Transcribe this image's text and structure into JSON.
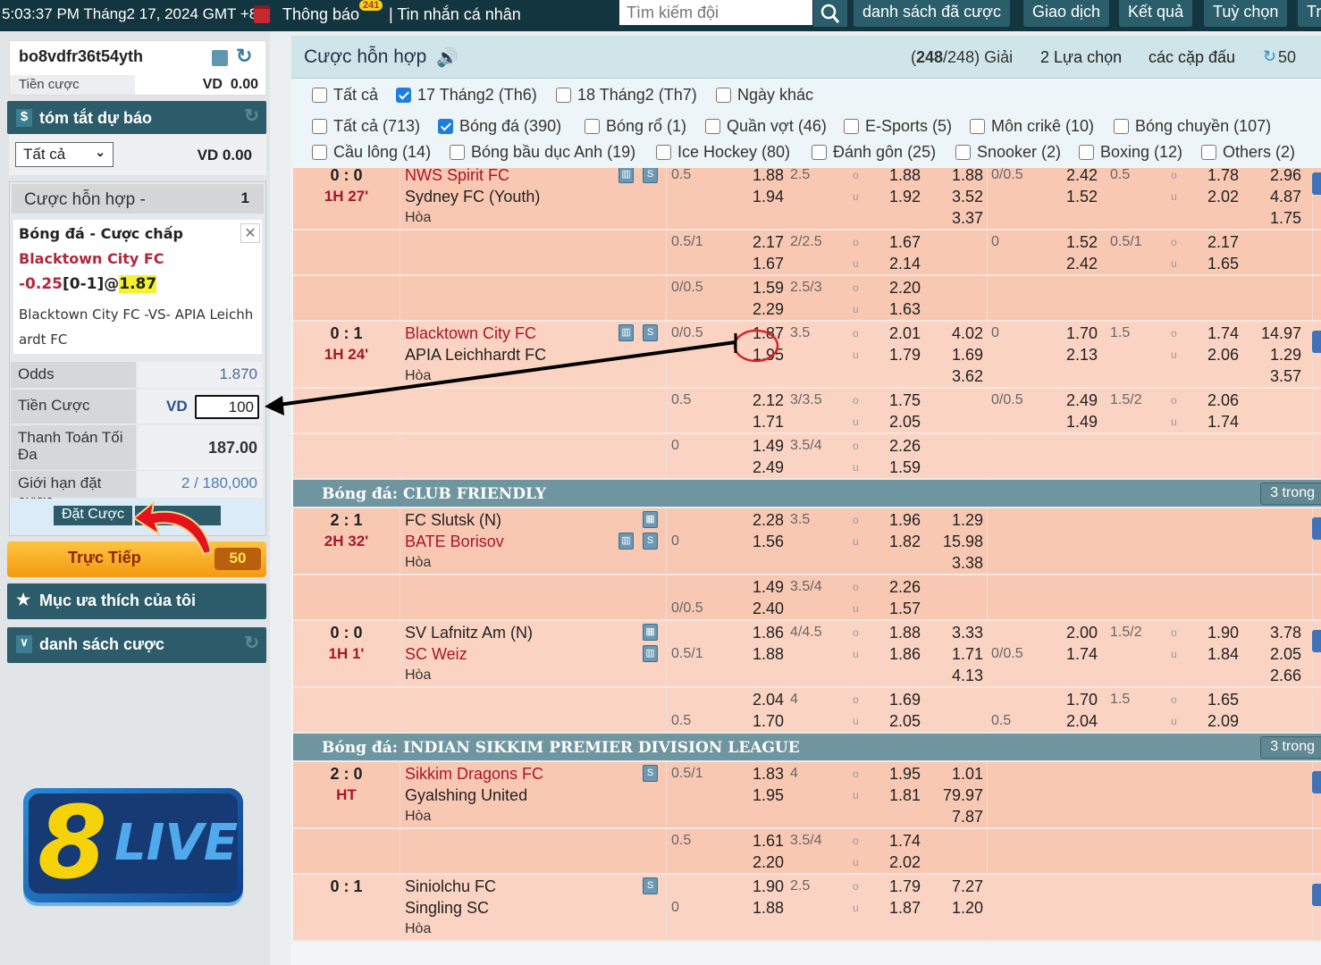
{
  "topbar": {
    "datetime": "5:03:37 PM Tháng2 17, 2024 GMT +8",
    "notifications_label": "Thông báo",
    "notifications_count": "241",
    "messages_label": "| Tin nhắn cá nhân",
    "search_placeholder": "Tìm kiếm đội",
    "nav": [
      "danh sách đã cược",
      "Giao dịch",
      "Kết quả",
      "Tuỳ chọn",
      "Tr"
    ]
  },
  "account": {
    "username": "bo8vdfr36t54yth",
    "balance_label": "Tiền cược",
    "balance_value": "VD  0.00"
  },
  "summary": {
    "title": "tóm tắt dự báo",
    "filter_selected": "Tất cả",
    "amount": "VD 0.00"
  },
  "betslip": {
    "title": "Cược hỗn hợp -",
    "count": "1",
    "bet_type": "Bóng đá - Cược chấp",
    "team": "Blacktown City FC",
    "handicap": "-0.25",
    "score": "[0-1]@",
    "odds_highlight": "1.87",
    "match": "Blacktown City FC -VS- APIA Leichhardt FC",
    "rows": {
      "odds_label": "Odds",
      "odds_value": "1.870",
      "stake_label": "Tiền Cược",
      "currency": "VD",
      "stake_value": "100",
      "payout_label": "Thanh Toán Tối Đa",
      "payout_value": "187.00",
      "limit_label": "Giới hạn đặt cược",
      "limit_value": "2 / 180,000"
    },
    "place_bet": "Đặt Cược"
  },
  "live": {
    "label": "Trực Tiếp",
    "count": "50"
  },
  "favorites": {
    "label": "Mục ưa thích của tôi"
  },
  "betlist": {
    "label": "danh sách cược"
  },
  "logo": {
    "text": "8LIVE"
  },
  "header": {
    "title": "Cược hỗn hợp",
    "leagues_count_a": "248",
    "leagues_count_b": "/248)",
    "leagues_label": "Giải",
    "selections": "2 Lựa chọn",
    "matchups": "các cặp đấu",
    "refresh": "50"
  },
  "filters": {
    "dates": [
      {
        "label": "Tất cả",
        "checked": false
      },
      {
        "label": "17 Tháng2 (Th6)",
        "checked": true
      },
      {
        "label": "18 Tháng2 (Th7)",
        "checked": false
      },
      {
        "label": "Ngày khác",
        "checked": false
      }
    ],
    "sports_row1": [
      {
        "label": "Tất cả (713)",
        "checked": false
      },
      {
        "label": "Bóng đá (390)",
        "checked": true
      },
      {
        "label": "Bóng rổ (1)",
        "checked": false
      },
      {
        "label": "Quần vợt (46)",
        "checked": false
      },
      {
        "label": "E-Sports (5)",
        "checked": false
      },
      {
        "label": "Môn crikê (10)",
        "checked": false
      },
      {
        "label": "Bóng chuyền (107)",
        "checked": false
      }
    ],
    "sports_row2": [
      {
        "label": "Cầu lông (14)",
        "checked": false
      },
      {
        "label": "Bóng bầu dục Anh (19)",
        "checked": false
      },
      {
        "label": "Ice Hockey (80)",
        "checked": false
      },
      {
        "label": "Đánh gôn (25)",
        "checked": false
      },
      {
        "label": "Snooker (2)",
        "checked": false
      },
      {
        "label": "Boxing (12)",
        "checked": false
      },
      {
        "label": "Others (2)",
        "checked": false
      }
    ]
  },
  "table": [
    {
      "type": "match",
      "score": "0 : 0",
      "time": "1H 27'",
      "home": "NWS Spirit FC",
      "away": "Sydney FC (Youth)",
      "draw": "Hòa",
      "fav": "home",
      "icons": [
        [
          "stats",
          "live"
        ],
        []
      ],
      "subs": [
        {
          "ft": {
            "line": "0.5",
            "line_row": 0,
            "h": "1.88",
            "a": "1.94",
            "ou": "2.5",
            "o": "1.88",
            "u": "1.92",
            "x": [
              "1.88",
              "3.52",
              "3.37"
            ]
          },
          "ht": {
            "line": "0/0.5",
            "line_row": 0,
            "h": "2.42",
            "a": "1.52",
            "ou": "0.5",
            "o": "1.78",
            "u": "2.02",
            "x": [
              "2.96",
              "4.87",
              "1.75"
            ]
          }
        },
        {
          "ft": {
            "line": "0.5/1",
            "line_row": 0,
            "h": "2.17",
            "a": "1.67",
            "ou": "2/2.5",
            "o": "1.67",
            "u": "2.14"
          },
          "ht": {
            "line": "0",
            "line_row": 0,
            "h": "1.52",
            "a": "2.42",
            "ou": "0.5/1",
            "o": "2.17",
            "u": "1.65"
          }
        },
        {
          "ft": {
            "line": "0/0.5",
            "line_row": 0,
            "h": "1.59",
            "a": "2.29",
            "ou": "2.5/3",
            "o": "2.20",
            "u": "1.63"
          }
        }
      ]
    },
    {
      "type": "match",
      "score": "0 : 1",
      "time": "1H 24'",
      "home": "Blacktown City FC",
      "away": "APIA Leichhardt FC",
      "draw": "Hòa",
      "fav": "home",
      "icons": [
        [
          "stats",
          "live"
        ],
        []
      ],
      "subs": [
        {
          "ft": {
            "line": "0/0.5",
            "line_row": 0,
            "h": "1.87",
            "a": "1.95",
            "ou": "3.5",
            "o": "2.01",
            "u": "1.79",
            "x": [
              "4.02",
              "1.69",
              "3.62"
            ]
          },
          "ht": {
            "line": "0",
            "line_row": 0,
            "h": "1.70",
            "a": "2.13",
            "ou": "1.5",
            "o": "1.74",
            "u": "2.06",
            "x": [
              "14.97",
              "1.29",
              "3.57"
            ]
          }
        },
        {
          "ft": {
            "line": "0.5",
            "line_row": 0,
            "h": "2.12",
            "a": "1.71",
            "ou": "3/3.5",
            "o": "1.75",
            "u": "2.05"
          },
          "ht": {
            "line": "0/0.5",
            "line_row": 0,
            "h": "2.49",
            "a": "1.49",
            "ou": "1.5/2",
            "o": "2.06",
            "u": "1.74"
          }
        },
        {
          "ft": {
            "line": "0",
            "line_row": 0,
            "h": "1.49",
            "a": "2.49",
            "ou": "3.5/4",
            "o": "2.26",
            "u": "1.59"
          }
        }
      ]
    },
    {
      "type": "league",
      "name": "Bóng đá: CLUB FRIENDLY",
      "more": "3 trong"
    },
    {
      "type": "match",
      "score": "2 : 1",
      "time": "2H 32'",
      "home": "FC Slutsk (N)",
      "away": "BATE Borisov",
      "draw": "Hòa",
      "fav": "away",
      "icons": [
        [
          "field"
        ],
        [
          "stats",
          "live"
        ]
      ],
      "subs": [
        {
          "ft": {
            "line": "0",
            "line_row": 1,
            "h": "2.28",
            "a": "1.56",
            "ou": "3.5",
            "o": "1.96",
            "u": "1.82",
            "x": [
              "1.29",
              "15.98",
              "3.38"
            ]
          }
        },
        {
          "ft": {
            "line": "0/0.5",
            "line_row": 1,
            "h": "1.49",
            "a": "2.40",
            "ou": "3.5/4",
            "o": "2.26",
            "u": "1.57"
          }
        }
      ]
    },
    {
      "type": "match",
      "score": "0 : 0",
      "time": "1H 1'",
      "home": "SV Lafnitz Am (N)",
      "away": "SC Weiz",
      "draw": "Hòa",
      "fav": "away",
      "icons": [
        [
          "field"
        ],
        [
          "stats"
        ]
      ],
      "subs": [
        {
          "ft": {
            "line": "0.5/1",
            "line_row": 1,
            "h": "1.86",
            "a": "1.88",
            "ou": "4/4.5",
            "o": "1.88",
            "u": "1.86",
            "x": [
              "3.33",
              "1.71",
              "4.13"
            ]
          },
          "ht": {
            "line": "0/0.5",
            "line_row": 1,
            "h": "2.00",
            "a": "1.74",
            "ou": "1.5/2",
            "o": "1.90",
            "u": "1.84",
            "x": [
              "3.78",
              "2.05",
              "2.66"
            ]
          }
        },
        {
          "ft": {
            "line": "0.5",
            "line_row": 1,
            "h": "2.04",
            "a": "1.70",
            "ou": "4",
            "o": "1.69",
            "u": "2.05"
          },
          "ht": {
            "line": "0.5",
            "line_row": 1,
            "h": "1.70",
            "a": "2.04",
            "ou": "1.5",
            "o": "1.65",
            "u": "2.09"
          }
        }
      ]
    },
    {
      "type": "league",
      "name": "Bóng đá: INDIAN SIKKIM PREMIER DIVISION LEAGUE",
      "more": "3 trong"
    },
    {
      "type": "match",
      "score": "2 : 0",
      "time": "HT",
      "home": "Sikkim Dragons FC",
      "away": "Gyalshing United",
      "draw": "Hòa",
      "fav": "home",
      "icons": [
        [
          "live"
        ],
        []
      ],
      "subs": [
        {
          "ft": {
            "line": "0.5/1",
            "line_row": 0,
            "h": "1.83",
            "a": "1.95",
            "ou": "4",
            "o": "1.95",
            "u": "1.81",
            "x": [
              "1.01",
              "79.97",
              "7.87"
            ]
          }
        },
        {
          "ft": {
            "line": "0.5",
            "line_row": 0,
            "h": "1.61",
            "a": "2.20",
            "ou": "3.5/4",
            "o": "1.74",
            "u": "2.02"
          }
        }
      ]
    },
    {
      "type": "match",
      "score": "0 : 1",
      "time": "",
      "home": "Siniolchu FC",
      "away": "Singling SC",
      "draw": "Hòa",
      "fav": "none",
      "icons": [
        [
          "live"
        ],
        []
      ],
      "subs": [
        {
          "ft": {
            "line": "0",
            "line_row": 1,
            "h": "1.90",
            "a": "1.88",
            "ou": "2.5",
            "o": "1.79",
            "u": "1.87",
            "x": [
              "7.27",
              "1.20",
              ""
            ]
          }
        }
      ]
    }
  ],
  "colors": {
    "row_a": "#f9c8b3",
    "row_b": "#fbd3c2",
    "accent": "#2c5c6a",
    "live": "#f7a21b"
  }
}
